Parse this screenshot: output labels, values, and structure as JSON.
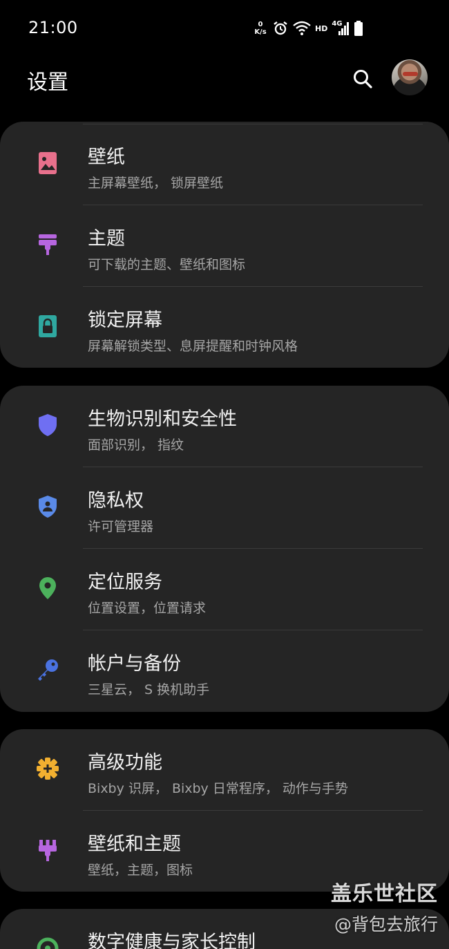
{
  "status_bar": {
    "time": "21:00",
    "net_speed_value": "0",
    "net_speed_unit": "K/s",
    "hd_label": "HD",
    "network_label": "4G"
  },
  "header": {
    "title": "设置"
  },
  "sections": [
    {
      "items": [
        {
          "title": "壁纸",
          "subtitle": "主屏幕壁纸， 锁屏壁纸",
          "icon": "wallpaper-icon",
          "color": "#e8708c"
        },
        {
          "title": "主题",
          "subtitle": "可下载的主题、壁纸和图标",
          "icon": "theme-brush-icon",
          "color": "#b766e0"
        },
        {
          "title": "锁定屏幕",
          "subtitle": "屏幕解锁类型、息屏提醒和时钟风格",
          "icon": "lock-screen-icon",
          "color": "#2fa8a0"
        }
      ]
    },
    {
      "items": [
        {
          "title": "生物识别和安全性",
          "subtitle": "面部识别， 指纹",
          "icon": "shield-icon",
          "color": "#6f6ff2"
        },
        {
          "title": "隐私权",
          "subtitle": "许可管理器",
          "icon": "privacy-shield-icon",
          "color": "#5a8ae8"
        },
        {
          "title": "定位服务",
          "subtitle": "位置设置，位置请求",
          "icon": "location-pin-icon",
          "color": "#4cb15c"
        },
        {
          "title": "帐户与备份",
          "subtitle": "三星云， S 换机助手",
          "icon": "key-icon",
          "color": "#4a72e0"
        }
      ]
    },
    {
      "items": [
        {
          "title": "高级功能",
          "subtitle": "Bixby 识屏， Bixby 日常程序， 动作与手势",
          "icon": "advanced-gear-icon",
          "color": "#f2b030"
        },
        {
          "title": "壁纸和主题",
          "subtitle": "壁纸，主题，图标",
          "icon": "wallpaper-theme-icon",
          "color": "#b766e0"
        }
      ]
    },
    {
      "items": [
        {
          "title": "数字健康与家长控制",
          "subtitle": "",
          "icon": "digital-wellbeing-icon",
          "color": "#4cb15c"
        }
      ]
    }
  ],
  "watermark": {
    "line1": "盖乐世社区",
    "line2": "@背包去旅行"
  },
  "colors": {
    "background": "#000000",
    "card": "#252525",
    "divider": "#3b3b3b",
    "title_text": "#f2f2f2",
    "subtitle_text": "#a6a6a6"
  }
}
